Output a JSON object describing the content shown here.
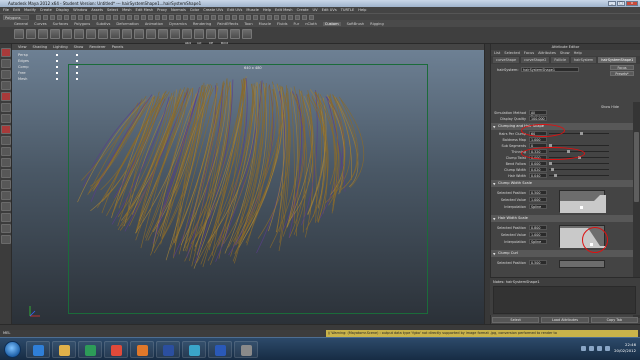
{
  "window": {
    "title": "Autodesk Maya 2012 x64 - Student Version: Untitled* --- hairSystemShape1...hairSystemShape1"
  },
  "menubar": [
    "File",
    "Edit",
    "Modify",
    "Create",
    "Display",
    "Window",
    "Assets",
    "Select",
    "Mesh",
    "Edit Mesh",
    "Proxy",
    "Normals",
    "Color",
    "Create UVs",
    "Edit UVs",
    "Muscle",
    "Help",
    "Edit Mesh",
    "Create",
    "UV",
    "Edit UVs",
    "TURTLE",
    "Help"
  ],
  "statusline": {
    "mode": "Polygons"
  },
  "shelf": {
    "tabs": [
      "General",
      "Curves",
      "Surfaces",
      "Polygons",
      "Subdivs",
      "Deformation",
      "Animation",
      "Dynamics",
      "Rendering",
      "PaintEffects",
      "Toon",
      "Muscle",
      "Fluids",
      "Fur",
      "nCloth",
      "Custom",
      "SoftBrush",
      "Rigging"
    ],
    "active_tab": "Custom",
    "icon_labels": [
      "Ab4",
      "ncl",
      "CP",
      "Rmd"
    ]
  },
  "viewport": {
    "menus": [
      "View",
      "Shading",
      "Lighting",
      "Show",
      "Renderer",
      "Panels"
    ],
    "outliner": [
      "Persp",
      "Edges",
      "Comp",
      "Free",
      "Mesh"
    ],
    "resolution": "640 x 480"
  },
  "attribute_editor": {
    "title": "Attribute Editor",
    "menus": [
      "List",
      "Selected",
      "Focus",
      "Attributes",
      "Show",
      "Help"
    ],
    "tabs": [
      "curveShape",
      "curveShape2",
      "Follicle",
      "hairSystem",
      "hairSystemShape1"
    ],
    "active_tab": "hairSystemShape1",
    "node_label": "hairSystem:",
    "node_value": "hairSystemShape1",
    "buttons": {
      "focus": "Focus",
      "presets": "Presets*"
    },
    "show_hide": "Show Hide",
    "top_fields": [
      {
        "label": "Simulation Method",
        "value": "All Follicles"
      },
      {
        "label": "Display Quality",
        "value": "100.000"
      }
    ],
    "clump_section": "Clumping and Hair Shape",
    "clump_fields": [
      {
        "label": "Hairs Per Clump",
        "value": "60",
        "knob": 0.55
      },
      {
        "label": "Baldness Map",
        "value": "1.000"
      },
      {
        "label": "Sub Segments",
        "value": "0",
        "knob": 0.0
      },
      {
        "label": "Thinning",
        "value": "0.320",
        "knob": 0.32
      },
      {
        "label": "Clump Twist",
        "value": "0.000",
        "knob": 0.5
      },
      {
        "label": "Bend Follow",
        "value": "0.000",
        "knob": 0.0
      },
      {
        "label": "Clump Width",
        "value": "0.020",
        "knob": 0.04
      },
      {
        "label": "Hair Width",
        "value": "0.040",
        "knob": 0.08
      }
    ],
    "clump_width_scale": {
      "title": "Clump Width Scale",
      "selected_position": "0.500",
      "selected_value": "1.000",
      "interpolation": "Spline"
    },
    "hair_width_scale": {
      "title": "Hair Width Scale",
      "selected_position": "0.800",
      "selected_value": "1.000",
      "interpolation": "Spline"
    },
    "clump_curl": {
      "title": "Clump Curl",
      "selected_position": "0.500"
    },
    "labels": {
      "sel_pos": "Selected Position",
      "sel_val": "Selected Value",
      "interp": "Interpolation"
    },
    "notes_label": "Notes:  hairSystemShape1",
    "bottom_buttons": [
      "Select",
      "Load Attributes",
      "Copy Tab"
    ]
  },
  "commandline": {
    "label": "MEL",
    "warning": "// Warning: (Mayatomr.Scene) : output data type 'fgbo' not directly supported by image format .jpg, conversion performed to render to"
  },
  "taskbar": {
    "time": "22:46",
    "date": "20/02/2012",
    "apps": [
      "ie-icon",
      "folder-icon",
      "media-icon",
      "chrome-icon",
      "firefox-icon",
      "photoshop-icon",
      "maya-icon",
      "word-icon",
      "misc-icon"
    ]
  },
  "colors": {
    "accent_red": "#dd1111",
    "hair": "#8a6a2a",
    "warning_bg": "#c9b34a"
  }
}
